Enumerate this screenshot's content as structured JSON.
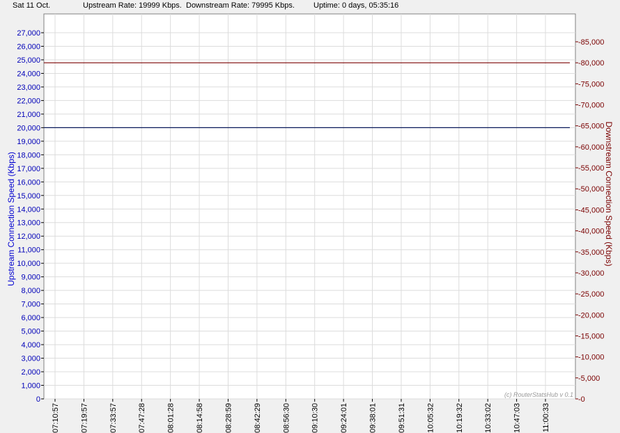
{
  "status": {
    "date": "Sat 11 Oct.",
    "upstream_rate": "Upstream Rate: 19999 Kbps.",
    "downstream_rate": "Downstream Rate: 79995 Kbps.",
    "uptime": "Uptime: 0 days, 05:35:16"
  },
  "credit": "(c) RouterStatsHub v 0.1",
  "colors": {
    "upstream": "#0a1a5a",
    "downstream": "#7a0000",
    "grid": "#dcdcdc",
    "plot_bg": "#ffffff"
  },
  "chart_data": {
    "type": "line",
    "x": [
      "07:10:57",
      "07:19:57",
      "07:33:57",
      "07:47:28",
      "08:01:28",
      "08:14:58",
      "08:28:59",
      "08:42:29",
      "08:56:30",
      "09:10:30",
      "09:24:01",
      "09:38:01",
      "09:51:31",
      "10:05:32",
      "10:19:32",
      "10:33:02",
      "10:47:03",
      "11:00:33"
    ],
    "y_left": {
      "label": "Upstream Connection Speed (Kbps)",
      "ylim": [
        0,
        27000
      ],
      "ticks": [
        0,
        1000,
        2000,
        3000,
        4000,
        5000,
        6000,
        7000,
        8000,
        9000,
        10000,
        11000,
        12000,
        13000,
        14000,
        15000,
        16000,
        17000,
        18000,
        19000,
        20000,
        21000,
        22000,
        23000,
        24000,
        25000,
        26000,
        27000
      ],
      "tick_labels": [
        "0",
        "1,000",
        "2,000",
        "3,000",
        "4,000",
        "5,000",
        "6,000",
        "7,000",
        "8,000",
        "9,000",
        "10,000",
        "11,000",
        "12,000",
        "13,000",
        "14,000",
        "15,000",
        "16,000",
        "17,000",
        "18,000",
        "19,000",
        "20,000",
        "21,000",
        "22,000",
        "23,000",
        "24,000",
        "25,000",
        "26,000",
        "27,000"
      ]
    },
    "y_right": {
      "label": "Downstream Connection Speed (Kbps)",
      "ylim": [
        0,
        85000
      ],
      "ticks": [
        0,
        5000,
        10000,
        15000,
        20000,
        25000,
        30000,
        35000,
        40000,
        45000,
        50000,
        55000,
        60000,
        65000,
        70000,
        75000,
        80000,
        85000
      ],
      "tick_labels": [
        "0",
        "5,000",
        "10,000",
        "15,000",
        "20,000",
        "25,000",
        "30,000",
        "35,000",
        "40,000",
        "45,000",
        "50,000",
        "55,000",
        "60,000",
        "65,000",
        "70,000",
        "75,000",
        "80,000",
        "85,000"
      ]
    },
    "series": [
      {
        "axis": "left",
        "values": [
          19999,
          19999,
          19999,
          19999,
          19999,
          19999,
          19999,
          19999,
          19999,
          19999,
          19999,
          19999,
          19999,
          19999,
          19999,
          19999,
          19999,
          19999
        ]
      },
      {
        "axis": "right",
        "values": [
          79995,
          79995,
          79995,
          79995,
          79995,
          79995,
          79995,
          79995,
          79995,
          79995,
          79995,
          79995,
          79995,
          79995,
          79995,
          79995,
          79995,
          79995
        ]
      }
    ],
    "grid": true
  }
}
